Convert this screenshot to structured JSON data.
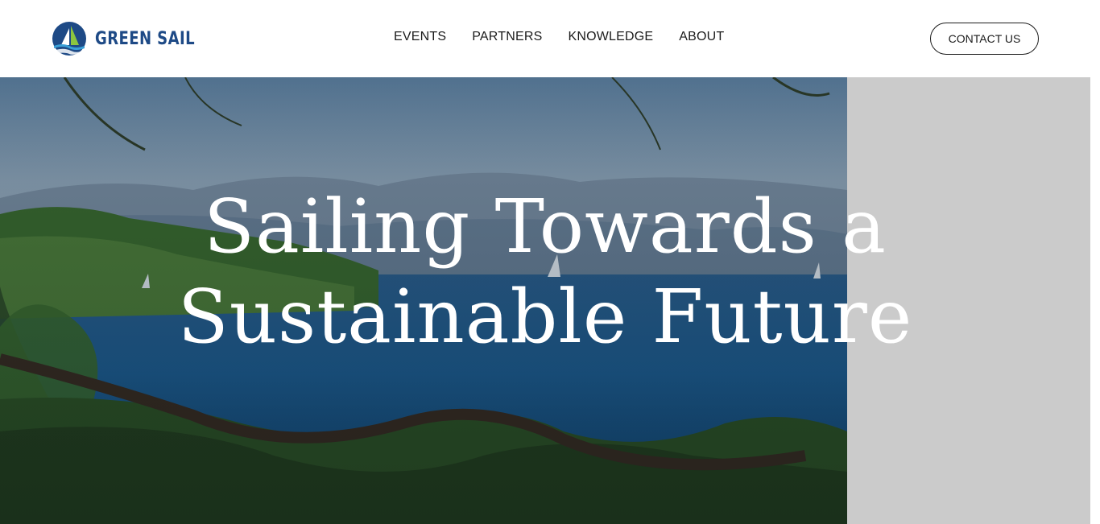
{
  "brand": {
    "name": "GREEN SAIL",
    "logo_icon": "sailboat-logo-icon",
    "color": "#1e4a86"
  },
  "nav": {
    "items": [
      {
        "label": "EVENTS"
      },
      {
        "label": "PARTNERS"
      },
      {
        "label": "KNOWLEDGE"
      },
      {
        "label": "ABOUT"
      }
    ]
  },
  "header": {
    "contact_label": "CONTACT US"
  },
  "hero": {
    "title_line1": "Sailing Towards a",
    "title_line2": "Sustainable Future",
    "image_icon": "coastal-seascape-image"
  },
  "colors": {
    "side_panel": "#cbcbcb",
    "sea": "#1d5f95",
    "foliage": "#3f6f2a"
  }
}
